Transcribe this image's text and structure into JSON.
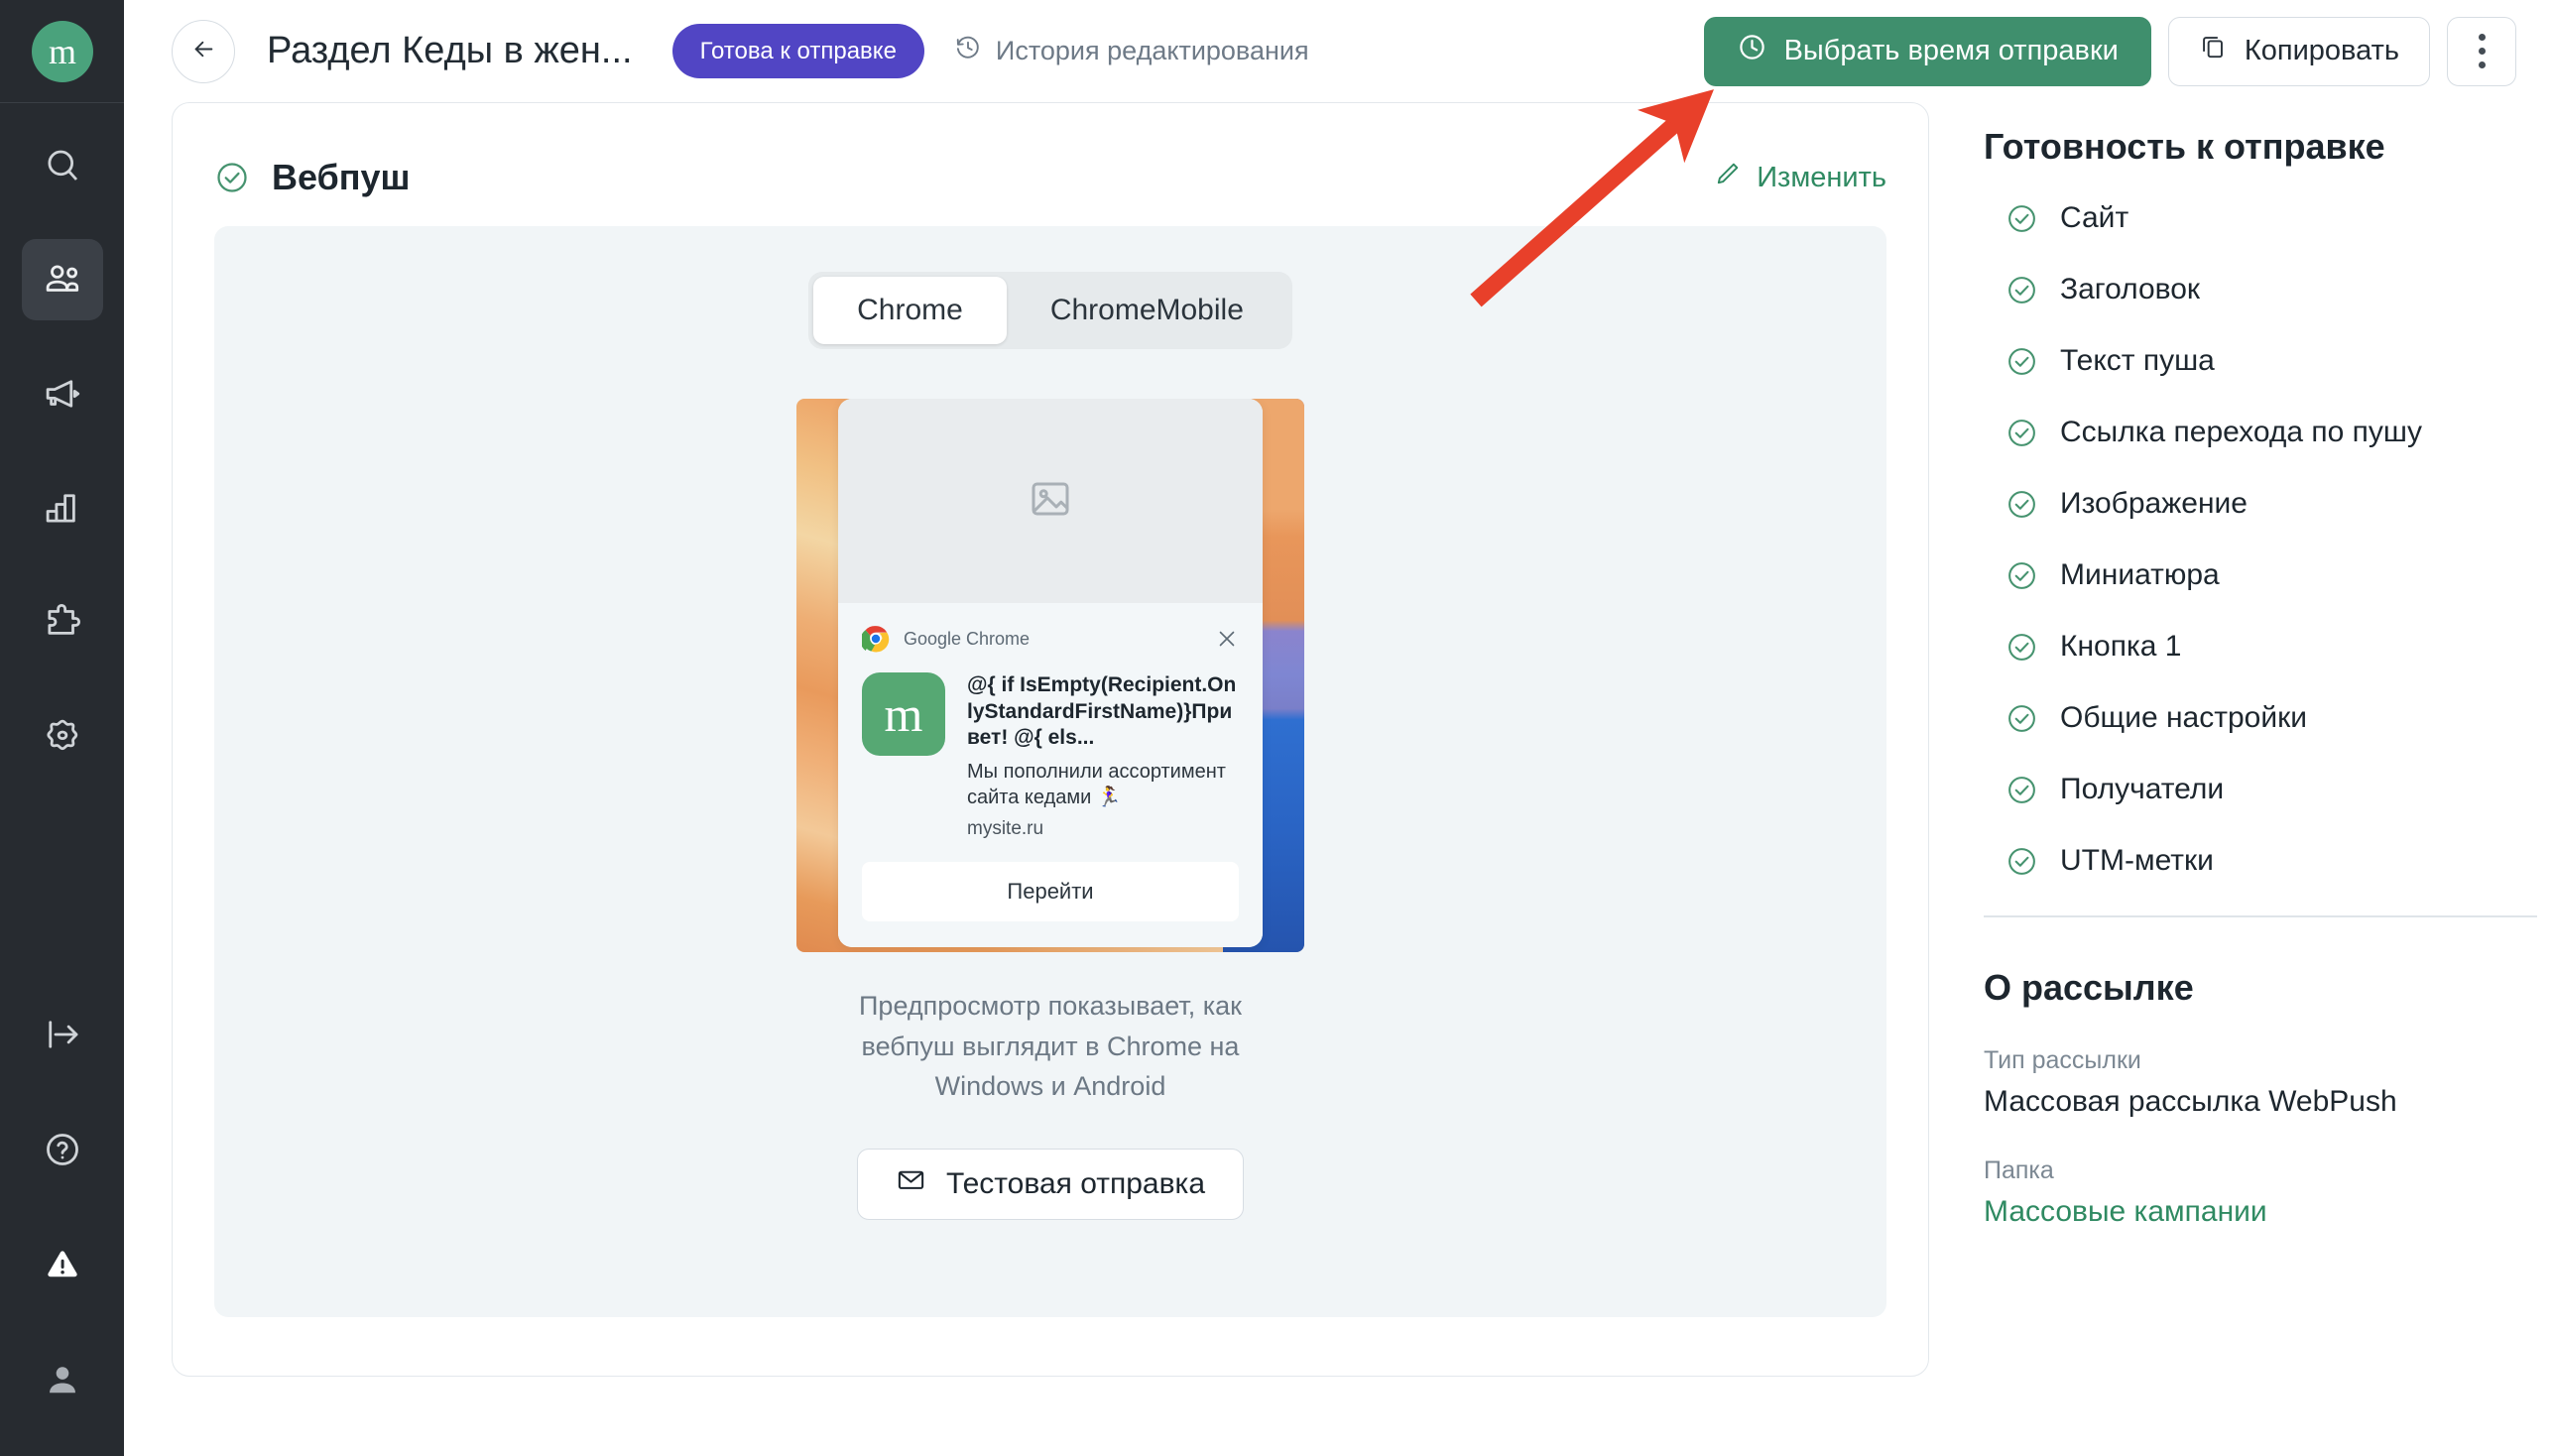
{
  "app": {
    "logo_letter": "m"
  },
  "rail": {
    "items": [
      {
        "name": "search-icon",
        "label": "Поиск",
        "active": false
      },
      {
        "name": "contacts-icon",
        "label": "Контакты",
        "active": true
      },
      {
        "name": "megaphone-icon",
        "label": "Рассылки",
        "active": false
      },
      {
        "name": "analytics-icon",
        "label": "Аналитика",
        "active": false
      },
      {
        "name": "integrations-icon",
        "label": "Интеграции",
        "active": false
      },
      {
        "name": "settings-icon",
        "label": "Настройки",
        "active": false
      }
    ],
    "bottom_items": [
      {
        "name": "logout-icon",
        "label": "Выход"
      },
      {
        "name": "help-icon",
        "label": "Помощь"
      },
      {
        "name": "warning-icon",
        "label": "Предупреждение"
      },
      {
        "name": "account-icon",
        "label": "Аккаунт"
      }
    ]
  },
  "header": {
    "back_label": "Назад",
    "title": "Раздел Кеды в жен...",
    "status_badge": "Готова к отправке",
    "history_label": "История редактирования",
    "primary_button": "Выбрать время отправки",
    "copy_button": "Копировать",
    "kebab_label": "Ещё"
  },
  "card": {
    "title": "Вебпуш",
    "edit_label": "Изменить",
    "tabs": [
      {
        "label": "Chrome",
        "selected": true
      },
      {
        "label": "ChromeMobile",
        "selected": false
      }
    ],
    "push": {
      "app_name": "Google Chrome",
      "title": "@{ if IsEmpty(Recipient.OnlyStandardFirstName)}Привет! @{ els...",
      "text": "Мы пополнили ассортимент сайта кедами 🏃‍♀️",
      "url": "mysite.ru",
      "action_label": "Перейти",
      "icon_letter": "m"
    },
    "note": "Предпросмотр показывает, как вебпуш выглядит в Chrome на Windows и Android",
    "test_button": "Тестовая отправка"
  },
  "sidebar": {
    "readiness_title": "Готовность к отправке",
    "readiness_items": [
      "Сайт",
      "Заголовок",
      "Текст пуша",
      "Ссылка перехода по пушу",
      "Изображение",
      "Миниатюра",
      "Кнопка 1",
      "Общие настройки",
      "Получатели",
      "UTM-метки"
    ],
    "about_title": "О рассылке",
    "fields": [
      {
        "label": "Тип рассылки",
        "value": "Массовая рассылка WebPush",
        "is_link": false
      },
      {
        "label": "Папка",
        "value": "Массовые кампании",
        "is_link": true
      }
    ]
  },
  "colors": {
    "brand_green": "#3f8f6d",
    "accent_purple": "#5145c4",
    "rail_bg": "#272b30",
    "link_green": "#2f8a62",
    "annotation_red": "#e8402a"
  }
}
